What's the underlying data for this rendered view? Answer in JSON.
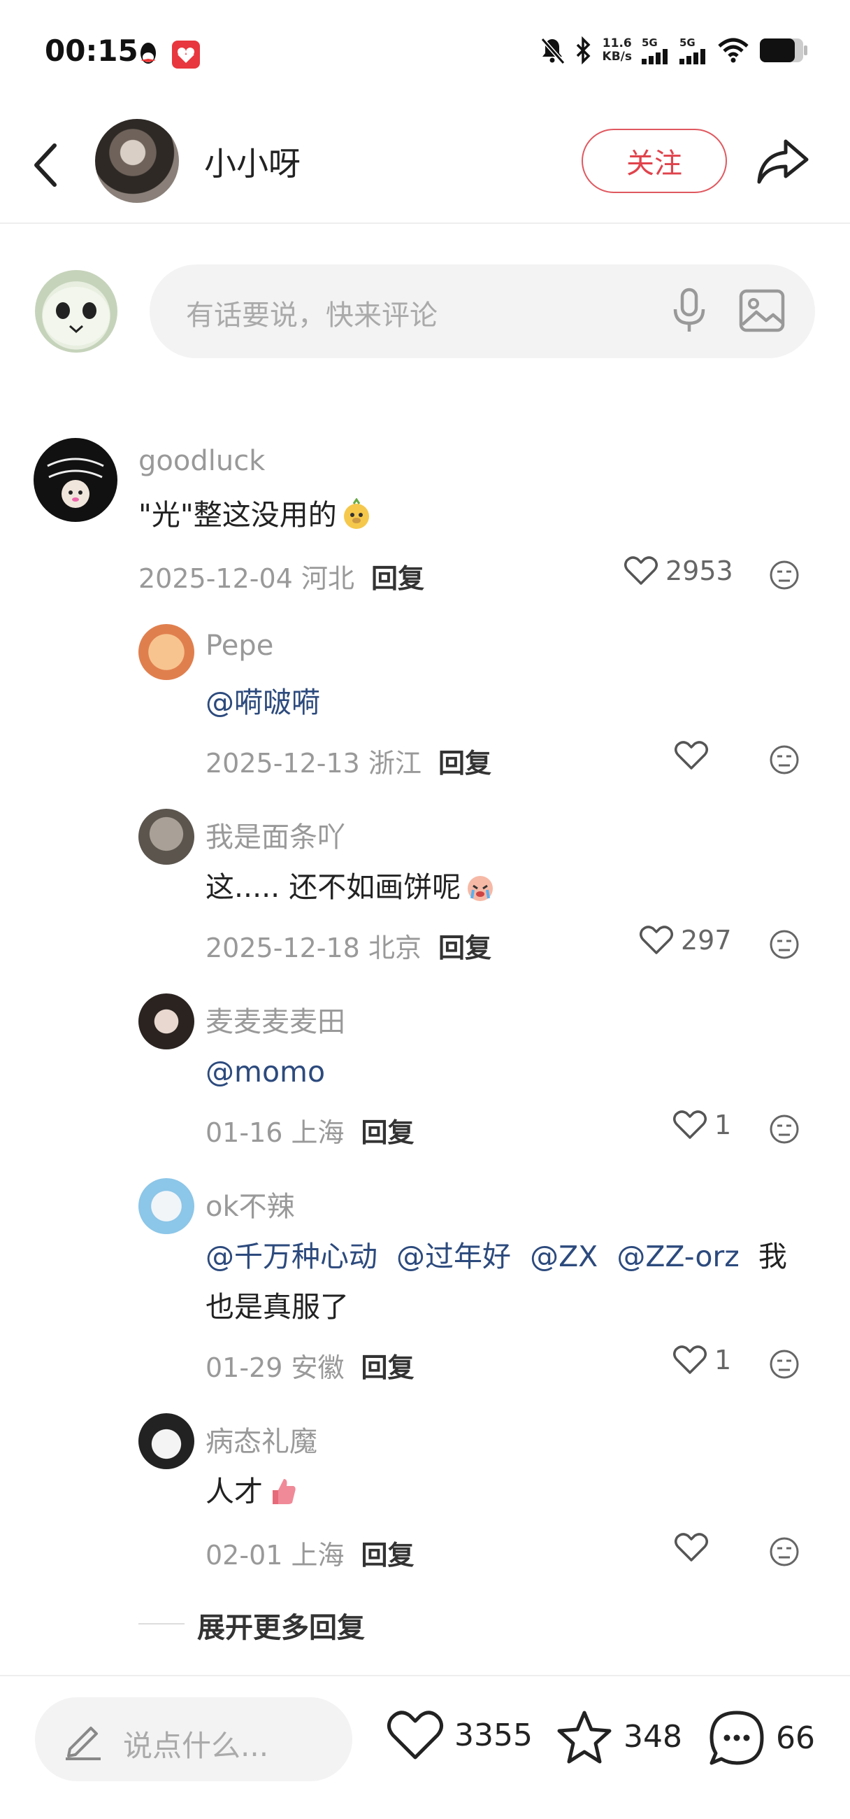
{
  "status_bar": {
    "time": "00:15",
    "net_speed_value": "11.6",
    "net_speed_unit": "KB/s",
    "sig1": "5G",
    "sig2": "5G"
  },
  "header": {
    "author_name": "小小呀",
    "follow_label": "关注"
  },
  "comment_input": {
    "placeholder": "有话要说，快来评论"
  },
  "top_comment": {
    "user": "goodluck",
    "text": "\"光\"整这没用的",
    "date": "2025-12-04",
    "location": "河北",
    "reply_label": "回复",
    "likes": "2953"
  },
  "replies": [
    {
      "user": "Pepe",
      "mention": "@嗬啵嗬",
      "date": "2025-12-13",
      "location": "浙江",
      "reply_label": "回复",
      "likes": ""
    },
    {
      "user": "我是面条吖",
      "text": "这..... 还不如画饼呢",
      "date": "2025-12-18",
      "location": "北京",
      "reply_label": "回复",
      "likes": "297"
    },
    {
      "user": "麦麦麦麦田",
      "mention": "@momo",
      "date": "01-16",
      "location": "上海",
      "reply_label": "回复",
      "likes": "1"
    },
    {
      "user": "ok不辣",
      "mentions": [
        "@千万种心动",
        "@过年好",
        "@ZX",
        "@ZZ-orz"
      ],
      "text_tail": "我",
      "text_line2": "也是真服了",
      "date": "01-29",
      "location": "安徽",
      "reply_label": "回复",
      "likes": "1"
    },
    {
      "user": "病态礼魔",
      "text": "人才",
      "date": "02-01",
      "location": "上海",
      "reply_label": "回复",
      "likes": ""
    }
  ],
  "more_replies_label": "展开更多回复",
  "bottom_bar": {
    "say_placeholder": "说点什么...",
    "likes": "3355",
    "stars": "348",
    "comments": "66"
  },
  "colors": {
    "accent_red": "#e0434c",
    "mention_blue": "#2c4a7d"
  }
}
